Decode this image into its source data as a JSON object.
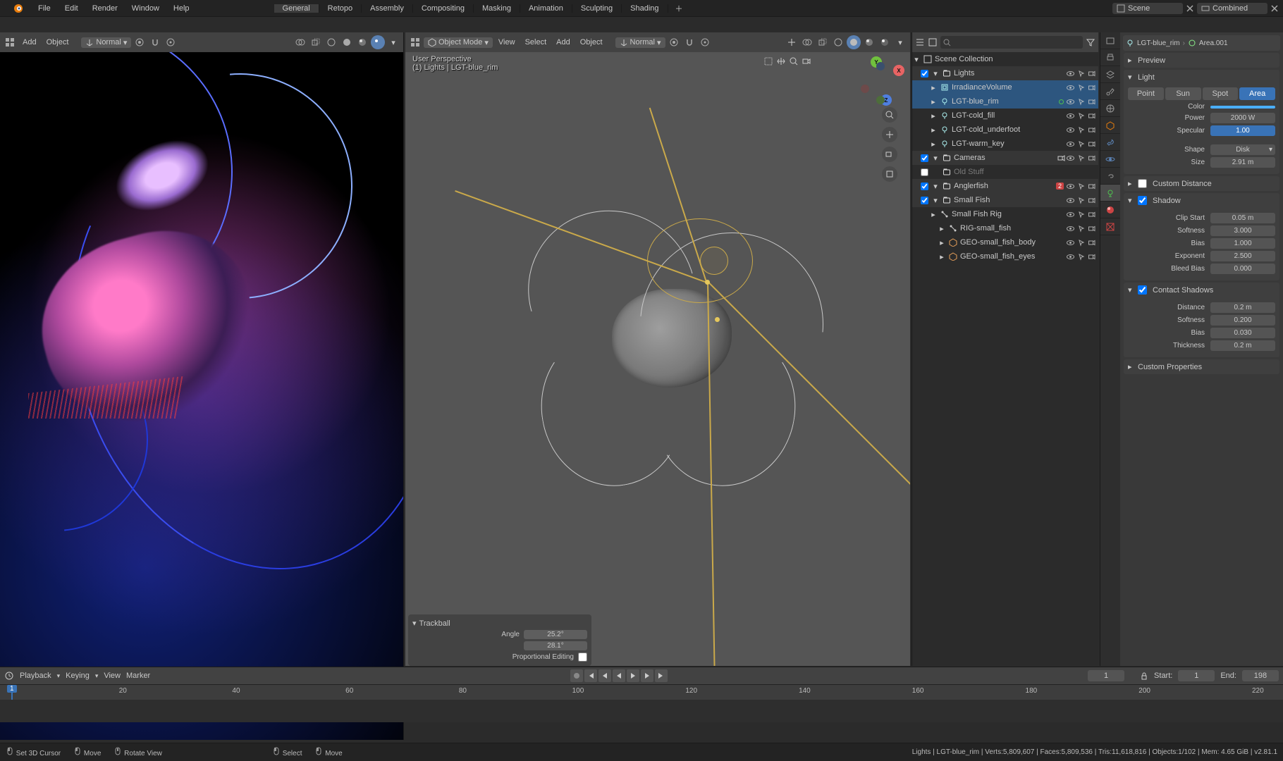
{
  "menubar": [
    "File",
    "Edit",
    "Render",
    "Window",
    "Help"
  ],
  "scene_field": "Scene",
  "viewlayer_field": "Combined",
  "workspace_tabs": [
    "General",
    "Retopo",
    "Assembly",
    "Compositing",
    "Masking",
    "Animation",
    "Sculpting",
    "Shading"
  ],
  "workspace_active": 0,
  "left_vp": {
    "header_menus": [
      "Add",
      "Object"
    ],
    "shading_label": "Normal"
  },
  "center_vp": {
    "mode": "Object Mode",
    "menus": [
      "View",
      "Select",
      "Add",
      "Object"
    ],
    "shading_label": "Normal",
    "overlay_persp": "User Perspective",
    "overlay_path": "(1) Lights | LGT-blue_rim",
    "trackball": {
      "title": "Trackball",
      "angle_label": "Angle",
      "angle1": "25.2°",
      "angle2": "28.1°",
      "prop_label": "Proportional Editing"
    }
  },
  "outliner": {
    "root": "Scene Collection",
    "items": [
      {
        "type": "collection",
        "depth": 1,
        "name": "Lights",
        "sel": false
      },
      {
        "type": "obj",
        "icon": "irradiance",
        "depth": 2,
        "name": "IrradianceVolume",
        "sel": true,
        "dim": false,
        "selHL": true
      },
      {
        "type": "obj",
        "icon": "light",
        "depth": 2,
        "name": "LGT-blue_rim",
        "sel": true,
        "active": true
      },
      {
        "type": "obj",
        "icon": "light",
        "depth": 2,
        "name": "LGT-cold_fill"
      },
      {
        "type": "obj",
        "icon": "light",
        "depth": 2,
        "name": "LGT-cold_underfoot"
      },
      {
        "type": "obj",
        "icon": "light",
        "depth": 2,
        "name": "LGT-warm_key"
      },
      {
        "type": "collection",
        "depth": 1,
        "name": "Cameras"
      },
      {
        "type": "label",
        "depth": 1,
        "name": "Old Stuff",
        "dim": true
      },
      {
        "type": "collection",
        "depth": 1,
        "name": "Anglerfish",
        "badge": "2"
      },
      {
        "type": "collection",
        "depth": 1,
        "name": "Small Fish"
      },
      {
        "type": "obj",
        "icon": "armature",
        "depth": 2,
        "name": "Small Fish Rig"
      },
      {
        "type": "obj",
        "icon": "armature",
        "depth": 3,
        "name": "RIG-small_fish"
      },
      {
        "type": "obj",
        "icon": "mesh",
        "depth": 3,
        "name": "GEO-small_fish_body"
      },
      {
        "type": "obj",
        "icon": "mesh",
        "depth": 3,
        "name": "GEO-small_fish_eyes"
      }
    ]
  },
  "breadcrumb": {
    "obj": "LGT-blue_rim",
    "data": "Area.001"
  },
  "light_panel": {
    "preview": "Preview",
    "light": "Light",
    "types": [
      "Point",
      "Sun",
      "Spot",
      "Area"
    ],
    "type_active": 3,
    "rows": [
      {
        "lbl": "Color",
        "val": "",
        "color": true
      },
      {
        "lbl": "Power",
        "val": "2000 W"
      },
      {
        "lbl": "Specular",
        "val": "1.00",
        "full": true
      }
    ],
    "shape_lbl": "Shape",
    "shape_val": "Disk",
    "size_lbl": "Size",
    "size_val": "2.91 m",
    "custom_distance": "Custom Distance",
    "shadow": "Shadow",
    "shadow_rows": [
      {
        "lbl": "Clip Start",
        "val": "0.05 m"
      },
      {
        "lbl": "Softness",
        "val": "3.000"
      },
      {
        "lbl": "Bias",
        "val": "1.000"
      },
      {
        "lbl": "Exponent",
        "val": "2.500"
      },
      {
        "lbl": "Bleed Bias",
        "val": "0.000"
      }
    ],
    "contact": "Contact Shadows",
    "contact_rows": [
      {
        "lbl": "Distance",
        "val": "0.2 m"
      },
      {
        "lbl": "Softness",
        "val": "0.200"
      },
      {
        "lbl": "Bias",
        "val": "0.030"
      },
      {
        "lbl": "Thickness",
        "val": "0.2 m"
      }
    ],
    "custom_props": "Custom Properties"
  },
  "timeline": {
    "menus": [
      "Playback",
      "Keying",
      "View",
      "Marker"
    ],
    "current": 1,
    "start_lbl": "Start:",
    "start": 1,
    "end_lbl": "End:",
    "end": 198,
    "ticks": [
      1,
      20,
      40,
      60,
      80,
      100,
      120,
      140,
      160,
      180,
      200,
      220
    ]
  },
  "status": {
    "left": [
      "Set 3D Cursor",
      "Move",
      "Rotate View",
      "Select",
      "Move"
    ],
    "right": "Lights | LGT-blue_rim | Verts:5,809,607 | Faces:5,809,536 | Tris:11,618,816 | Objects:1/102 | Mem: 4.65 GiB | v2.81.1"
  }
}
